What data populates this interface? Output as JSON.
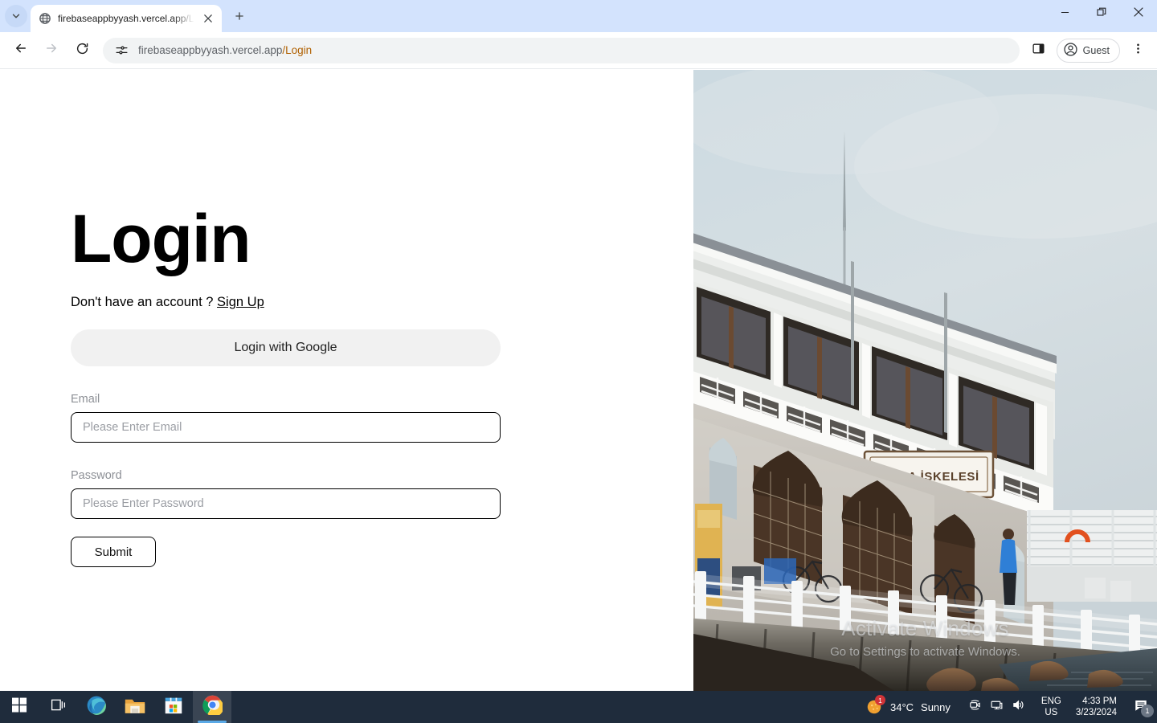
{
  "browser": {
    "tab": {
      "title": "firebaseappbyyash.vercel.app/L",
      "favicon_icon": "globe-icon",
      "close_icon": "close-icon",
      "tab_search_icon": "chevron-down-icon",
      "new_tab_icon": "plus-icon"
    },
    "window_controls": {
      "minimize_icon": "minimize-icon",
      "restore_icon": "restore-icon",
      "close_icon": "close-icon"
    },
    "toolbar": {
      "back_icon": "arrow-left-icon",
      "forward_icon": "arrow-right-icon",
      "reload_icon": "reload-icon",
      "site_info_icon": "tune-sliders-icon",
      "url_host": "firebaseappbyyash.vercel.app",
      "url_path": "/Login",
      "side_panel_icon": "side-panel-icon",
      "profile_label": "Guest",
      "profile_icon": "person-circle-icon",
      "menu_icon": "three-dot-menu-icon"
    }
  },
  "page": {
    "title": "Login",
    "signup_prompt": "Don't have an account ?",
    "signup_link": "Sign Up",
    "google_button": "Login with Google",
    "email": {
      "label": "Email",
      "placeholder": "Please Enter Email",
      "value": ""
    },
    "password": {
      "label": "Password",
      "placeholder": "Please Enter Password",
      "value": ""
    },
    "submit_button": "Submit",
    "photo": {
      "sign_text": "MODA İSKELESİ",
      "description": "Moda Iskelesi ferry terminal building by the sea"
    }
  },
  "watermark": {
    "title": "Activate Windows",
    "subtitle": "Go to Settings to activate Windows."
  },
  "taskbar": {
    "apps": [
      {
        "name": "start-button",
        "icon": "windows-logo-icon",
        "active": false
      },
      {
        "name": "task-view-button",
        "icon": "task-view-icon",
        "active": false
      },
      {
        "name": "taskbar-edge",
        "icon": "edge-icon",
        "active": false
      },
      {
        "name": "taskbar-file-explorer",
        "icon": "folder-icon",
        "active": false
      },
      {
        "name": "taskbar-microsoft-store",
        "icon": "store-icon",
        "active": false
      },
      {
        "name": "taskbar-chrome",
        "icon": "chrome-icon",
        "active": true
      }
    ],
    "weather": {
      "temperature": "34°C",
      "condition": "Sunny",
      "icon": "sun-icon",
      "badge": "1"
    },
    "tray_icons": [
      "meet-now-icon",
      "network-icon",
      "volume-icon"
    ],
    "language": {
      "line1": "ENG",
      "line2": "US"
    },
    "clock": {
      "time": "4:33 PM",
      "date": "3/23/2024"
    },
    "notifications": {
      "icon": "notification-icon",
      "count": "1"
    }
  },
  "colors": {
    "tabstrip": "#d3e3fd",
    "taskbar": "#1f2c3c",
    "google_btn": "#f1f1f1",
    "url_path": "#b06000"
  }
}
